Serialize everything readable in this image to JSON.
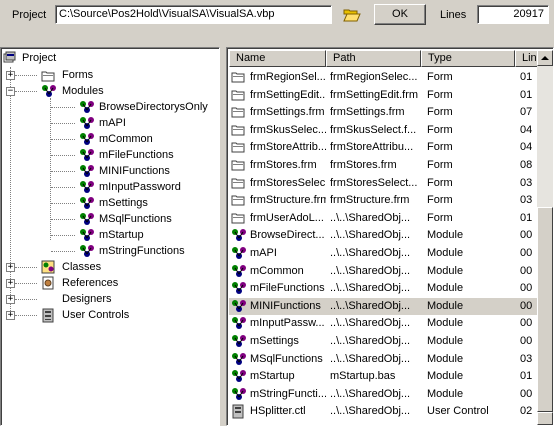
{
  "toolbar": {
    "project_label": "Project",
    "project_path": "C:\\Source\\Pos2Hold\\VisualSA\\VisualSA.vbp",
    "open_folder_icon": "open-folder-icon",
    "ok_label": "OK",
    "lines_label": "Lines",
    "lines_value": "20917"
  },
  "tree": {
    "root": "Project",
    "nodes": [
      {
        "label": "Forms",
        "icon": "folder-icon",
        "state": "+"
      },
      {
        "label": "Modules",
        "icon": "module-icon",
        "state": "-"
      },
      {
        "label": "BrowseDirectorysOnly",
        "icon": "module-icon"
      },
      {
        "label": "mAPI",
        "icon": "module-icon"
      },
      {
        "label": "mCommon",
        "icon": "module-icon"
      },
      {
        "label": "mFileFunctions",
        "icon": "module-icon"
      },
      {
        "label": "MINIFunctions",
        "icon": "module-icon"
      },
      {
        "label": "mInputPassword",
        "icon": "module-icon"
      },
      {
        "label": "mSettings",
        "icon": "module-icon"
      },
      {
        "label": "MSqlFunctions",
        "icon": "module-icon"
      },
      {
        "label": "mStartup",
        "icon": "module-icon"
      },
      {
        "label": "mStringFunctions",
        "icon": "module-icon"
      },
      {
        "label": "Classes",
        "icon": "class-icon",
        "state": "+"
      },
      {
        "label": "References",
        "icon": "references-icon",
        "state": "+"
      },
      {
        "label": "Designers",
        "icon": "",
        "state": "+"
      },
      {
        "label": "User Controls",
        "icon": "user-control-icon",
        "state": "+"
      }
    ]
  },
  "list": {
    "headers": [
      "Name",
      "Path",
      "Type",
      "Lin"
    ],
    "rows": [
      {
        "name": "frmRegionSel...",
        "path": "frmRegionSelec...",
        "type": "Form",
        "lines": "01",
        "icon": "form-icon"
      },
      {
        "name": "frmSettingEdit...",
        "path": "frmSettingEdit.frm",
        "type": "Form",
        "lines": "01",
        "icon": "form-icon"
      },
      {
        "name": "frmSettings.frm",
        "path": "frmSettings.frm",
        "type": "Form",
        "lines": "07",
        "icon": "form-icon"
      },
      {
        "name": "frmSkusSelec...",
        "path": "frmSkusSelect.f...",
        "type": "Form",
        "lines": "04",
        "icon": "form-icon"
      },
      {
        "name": "frmStoreAttrib...",
        "path": "frmStoreAttribu...",
        "type": "Form",
        "lines": "04",
        "icon": "form-icon"
      },
      {
        "name": "frmStores.frm",
        "path": "frmStores.frm",
        "type": "Form",
        "lines": "08",
        "icon": "form-icon"
      },
      {
        "name": "frmStoresSelec...",
        "path": "frmStoresSelect...",
        "type": "Form",
        "lines": "03",
        "icon": "form-icon"
      },
      {
        "name": "frmStructure.frm",
        "path": "frmStructure.frm",
        "type": "Form",
        "lines": "03",
        "icon": "form-icon"
      },
      {
        "name": "frmUserAdoL...",
        "path": "..\\..\\SharedObj...",
        "type": "Form",
        "lines": "01",
        "icon": "form-icon"
      },
      {
        "name": "BrowseDirect...",
        "path": "..\\..\\SharedObj...",
        "type": "Module",
        "lines": "00",
        "icon": "module-icon"
      },
      {
        "name": "mAPI",
        "path": "..\\..\\SharedObj...",
        "type": "Module",
        "lines": "00",
        "icon": "module-icon"
      },
      {
        "name": "mCommon",
        "path": "..\\..\\SharedObj...",
        "type": "Module",
        "lines": "00",
        "icon": "module-icon"
      },
      {
        "name": "mFileFunctions",
        "path": "..\\..\\SharedObj...",
        "type": "Module",
        "lines": "00",
        "icon": "module-icon"
      },
      {
        "name": "MINIFunctions",
        "path": "..\\..\\SharedObj...",
        "type": "Module",
        "lines": "00",
        "icon": "module-icon",
        "selected": true
      },
      {
        "name": "mInputPassw...",
        "path": "..\\..\\SharedObj...",
        "type": "Module",
        "lines": "00",
        "icon": "module-icon"
      },
      {
        "name": "mSettings",
        "path": "..\\..\\SharedObj...",
        "type": "Module",
        "lines": "00",
        "icon": "module-icon"
      },
      {
        "name": "MSqlFunctions",
        "path": "..\\..\\SharedObj...",
        "type": "Module",
        "lines": "03",
        "icon": "module-icon"
      },
      {
        "name": "mStartup",
        "path": "mStartup.bas",
        "type": "Module",
        "lines": "01",
        "icon": "module-icon"
      },
      {
        "name": "mStringFuncti...",
        "path": "..\\..\\SharedObj...",
        "type": "Module",
        "lines": "00",
        "icon": "module-icon"
      },
      {
        "name": "HSplitter.ctl",
        "path": "..\\..\\SharedObj...",
        "type": "User Control",
        "lines": "02",
        "icon": "user-control-icon"
      }
    ]
  },
  "colors": {
    "face": "#d4d0c8",
    "module_green": "#008000",
    "module_purple": "#800080"
  }
}
